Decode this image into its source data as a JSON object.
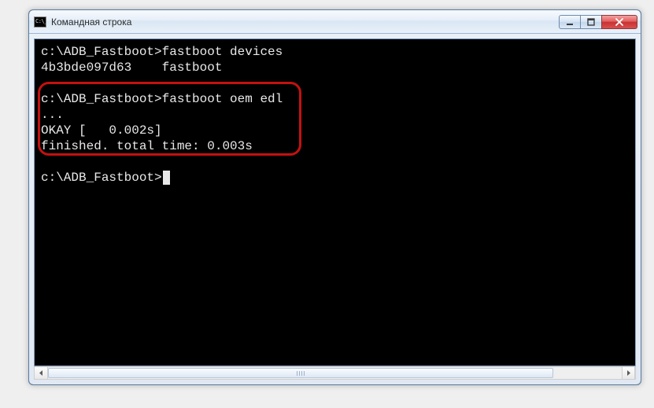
{
  "window": {
    "title": "Командная строка"
  },
  "terminal": {
    "line1_prompt": "c:\\ADB_Fastboot>",
    "line1_cmd": "fastboot devices",
    "line2": "4b3bde097d63    fastboot",
    "line3_prompt": "c:\\ADB_Fastboot>",
    "line3_cmd": "fastboot oem edl",
    "line4": "...",
    "line5": "OKAY [   0.002s]",
    "line6": "finished. total time: 0.003s",
    "line7_prompt": "c:\\ADB_Fastboot>"
  }
}
